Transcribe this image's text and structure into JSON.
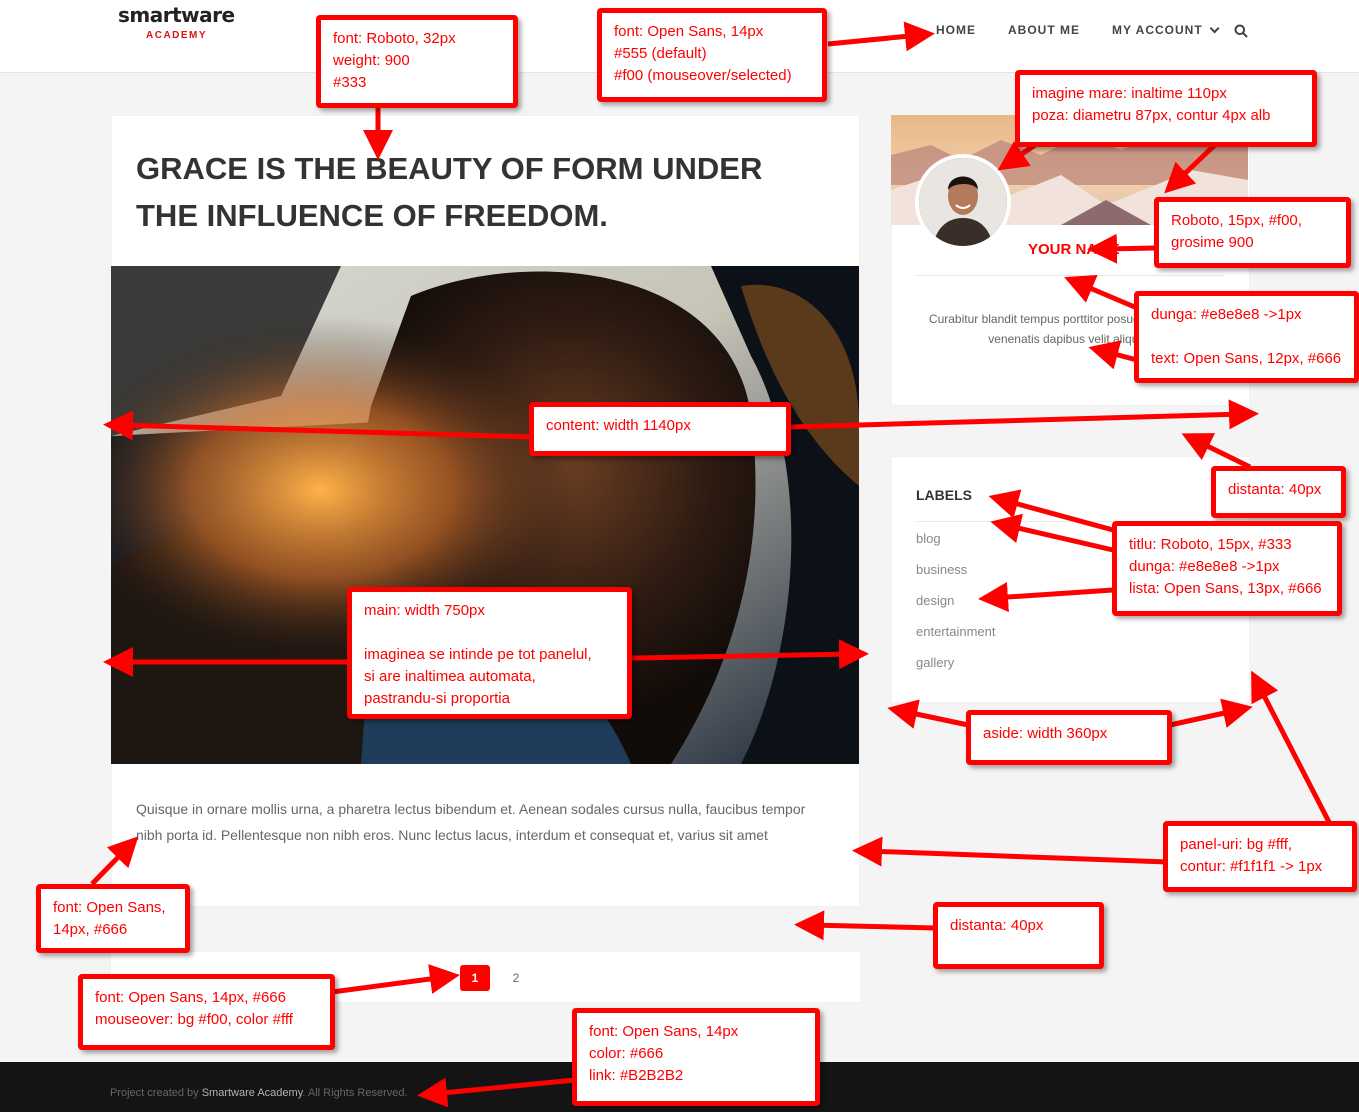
{
  "logo": {
    "main": "smartware",
    "sub": "ACADEMY"
  },
  "nav": {
    "items": [
      "HOME",
      "ABOUT ME",
      "MY ACCOUNT"
    ]
  },
  "post": {
    "title": "GRACE IS THE BEAUTY OF FORM UNDER THE INFLUENCE OF FREEDOM.",
    "text": "Quisque in ornare mollis urna, a pharetra lectus bibendum et. Aenean sodales cursus nulla, faucibus tempor nibh porta id. Pellentesque non nibh eros. Nunc lectus lacus, interdum et consequat et, varius sit amet"
  },
  "pagination": {
    "pages": [
      "1",
      "2"
    ],
    "active": "1"
  },
  "profile": {
    "name": "YOUR NAME",
    "bio": "Curabitur blandit tempus porttitor posuere erat a ante venenatis dapibus velit aliquet."
  },
  "labels": {
    "title": "LABELS",
    "items": [
      "blog",
      "business",
      "design",
      "entertainment",
      "gallery"
    ]
  },
  "footer": {
    "prefix": "Project created by ",
    "link": "Smartware Academy",
    "suffix": ". All Rights Reserved."
  },
  "annotations": {
    "title_font": "font: Roboto, 32px\nweight: 900\n#333",
    "nav_font": "font: Open Sans, 14px\n#555 (default)\n#f00 (mouseover/selected)",
    "banner": "imagine mare: inaltime 110px\npoza: diametru 87px, contur 4px alb",
    "name_font": "Roboto, 15px, #f00,\ngrosime 900",
    "bio_divider": "dunga: #e8e8e8 ->1px",
    "bio_text": "text: Open Sans, 12px, #666",
    "content_width": "content: width 1140px",
    "distance_top": "distanta: 40px",
    "labels_style": "titlu: Roboto, 15px, #333\ndunga: #e8e8e8 ->1px\nlista: Open Sans, 13px, #666",
    "main_width": "main: width 750px\n\nimaginea se intinde pe tot panelul,\nsi are inaltimea automata,\npastrandu-si proportia",
    "aside_width": "aside: width 360px",
    "panels": "panel-uri: bg #fff,\ncontur: #f1f1f1 -> 1px",
    "post_font": "font: Open Sans,\n14px, #666",
    "distance_bottom": "distanta: 40px",
    "pagination_font": "font: Open Sans, 14px, #666\nmouseover: bg #f00, color #fff",
    "footer_font": "font: Open Sans, 14px\ncolor: #666\nlink: #B2B2B2"
  },
  "colors": {
    "accent": "#f00",
    "title": "#333",
    "text": "#666",
    "divider": "#e8e8e8",
    "panel_border": "#f1f1f1",
    "footer_link": "#B2B2B2"
  }
}
